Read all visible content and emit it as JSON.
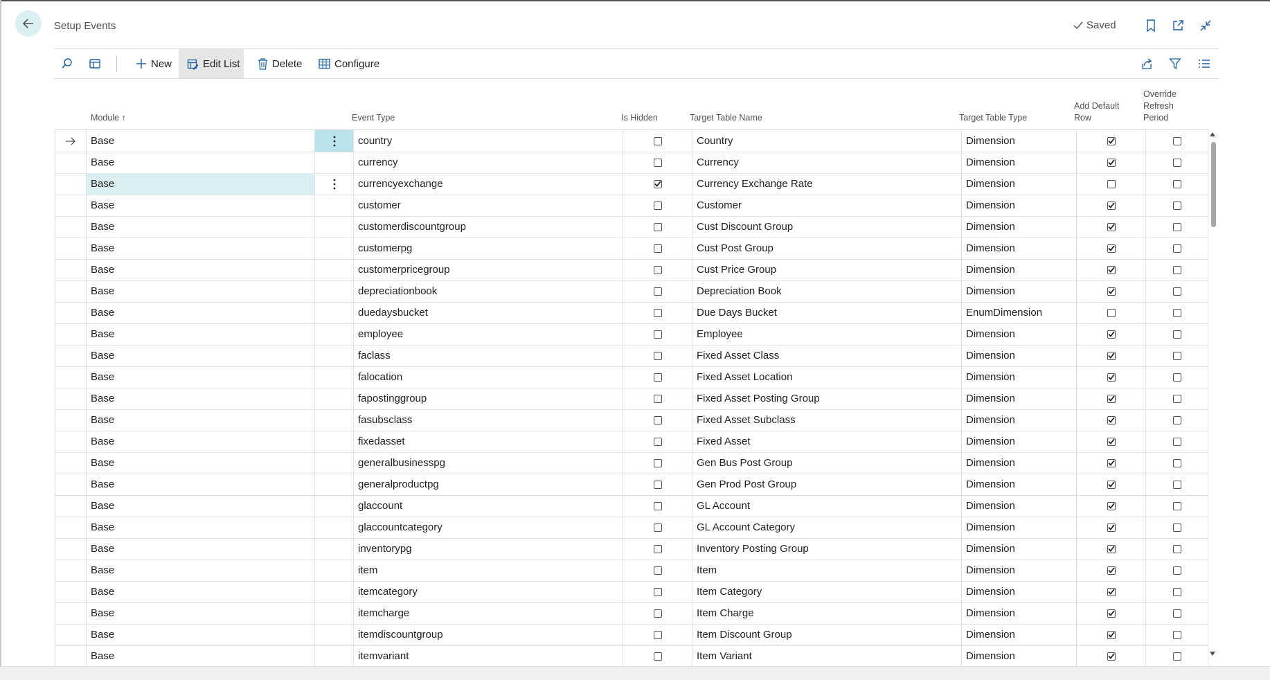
{
  "header": {
    "title": "Setup Events",
    "saved_label": "Saved"
  },
  "actions": {
    "new": "New",
    "edit_list": "Edit List",
    "delete": "Delete",
    "configure": "Configure"
  },
  "columns": {
    "module": "Module",
    "event_type": "Event Type",
    "is_hidden": "Is Hidden",
    "target_table_name": "Target Table Name",
    "target_table_type": "Target Table Type",
    "add_default_row": [
      "Add Default",
      "Row"
    ],
    "override_refresh_period": [
      "Override",
      "Refresh",
      "Period"
    ]
  },
  "rows": [
    {
      "module": "Base",
      "event_type": "country",
      "is_hidden": false,
      "target_table_name": "Country",
      "target_table_type": "Dimension",
      "add_default_row": true,
      "override_refresh_period": false
    },
    {
      "module": "Base",
      "event_type": "currency",
      "is_hidden": false,
      "target_table_name": "Currency",
      "target_table_type": "Dimension",
      "add_default_row": true,
      "override_refresh_period": false
    },
    {
      "module": "Base",
      "event_type": "currencyexchange",
      "is_hidden": true,
      "target_table_name": "Currency Exchange Rate",
      "target_table_type": "Dimension",
      "add_default_row": false,
      "override_refresh_period": false
    },
    {
      "module": "Base",
      "event_type": "customer",
      "is_hidden": false,
      "target_table_name": "Customer",
      "target_table_type": "Dimension",
      "add_default_row": true,
      "override_refresh_period": false
    },
    {
      "module": "Base",
      "event_type": "customerdiscountgroup",
      "is_hidden": false,
      "target_table_name": "Cust Discount Group",
      "target_table_type": "Dimension",
      "add_default_row": true,
      "override_refresh_period": false
    },
    {
      "module": "Base",
      "event_type": "customerpg",
      "is_hidden": false,
      "target_table_name": "Cust Post Group",
      "target_table_type": "Dimension",
      "add_default_row": true,
      "override_refresh_period": false
    },
    {
      "module": "Base",
      "event_type": "customerpricegroup",
      "is_hidden": false,
      "target_table_name": "Cust Price Group",
      "target_table_type": "Dimension",
      "add_default_row": true,
      "override_refresh_period": false
    },
    {
      "module": "Base",
      "event_type": "depreciationbook",
      "is_hidden": false,
      "target_table_name": "Depreciation Book",
      "target_table_type": "Dimension",
      "add_default_row": true,
      "override_refresh_period": false
    },
    {
      "module": "Base",
      "event_type": "duedaysbucket",
      "is_hidden": false,
      "target_table_name": "Due Days Bucket",
      "target_table_type": "EnumDimension",
      "add_default_row": false,
      "override_refresh_period": false
    },
    {
      "module": "Base",
      "event_type": "employee",
      "is_hidden": false,
      "target_table_name": "Employee",
      "target_table_type": "Dimension",
      "add_default_row": true,
      "override_refresh_period": false
    },
    {
      "module": "Base",
      "event_type": "faclass",
      "is_hidden": false,
      "target_table_name": "Fixed Asset Class",
      "target_table_type": "Dimension",
      "add_default_row": true,
      "override_refresh_period": false
    },
    {
      "module": "Base",
      "event_type": "falocation",
      "is_hidden": false,
      "target_table_name": "Fixed Asset Location",
      "target_table_type": "Dimension",
      "add_default_row": true,
      "override_refresh_period": false
    },
    {
      "module": "Base",
      "event_type": "fapostinggroup",
      "is_hidden": false,
      "target_table_name": "Fixed Asset Posting Group",
      "target_table_type": "Dimension",
      "add_default_row": true,
      "override_refresh_period": false
    },
    {
      "module": "Base",
      "event_type": "fasubsclass",
      "is_hidden": false,
      "target_table_name": "Fixed Asset Subclass",
      "target_table_type": "Dimension",
      "add_default_row": true,
      "override_refresh_period": false
    },
    {
      "module": "Base",
      "event_type": "fixedasset",
      "is_hidden": false,
      "target_table_name": "Fixed Asset",
      "target_table_type": "Dimension",
      "add_default_row": true,
      "override_refresh_period": false
    },
    {
      "module": "Base",
      "event_type": "generalbusinesspg",
      "is_hidden": false,
      "target_table_name": "Gen Bus Post Group",
      "target_table_type": "Dimension",
      "add_default_row": true,
      "override_refresh_period": false
    },
    {
      "module": "Base",
      "event_type": "generalproductpg",
      "is_hidden": false,
      "target_table_name": "Gen Prod Post Group",
      "target_table_type": "Dimension",
      "add_default_row": true,
      "override_refresh_period": false
    },
    {
      "module": "Base",
      "event_type": "glaccount",
      "is_hidden": false,
      "target_table_name": "GL Account",
      "target_table_type": "Dimension",
      "add_default_row": true,
      "override_refresh_period": false
    },
    {
      "module": "Base",
      "event_type": "glaccountcategory",
      "is_hidden": false,
      "target_table_name": "GL Account Category",
      "target_table_type": "Dimension",
      "add_default_row": true,
      "override_refresh_period": false
    },
    {
      "module": "Base",
      "event_type": "inventorypg",
      "is_hidden": false,
      "target_table_name": "Inventory Posting Group",
      "target_table_type": "Dimension",
      "add_default_row": true,
      "override_refresh_period": false
    },
    {
      "module": "Base",
      "event_type": "item",
      "is_hidden": false,
      "target_table_name": "Item",
      "target_table_type": "Dimension",
      "add_default_row": true,
      "override_refresh_period": false
    },
    {
      "module": "Base",
      "event_type": "itemcategory",
      "is_hidden": false,
      "target_table_name": "Item Category",
      "target_table_type": "Dimension",
      "add_default_row": true,
      "override_refresh_period": false
    },
    {
      "module": "Base",
      "event_type": "itemcharge",
      "is_hidden": false,
      "target_table_name": "Item Charge",
      "target_table_type": "Dimension",
      "add_default_row": true,
      "override_refresh_period": false
    },
    {
      "module": "Base",
      "event_type": "itemdiscountgroup",
      "is_hidden": false,
      "target_table_name": "Item Discount Group",
      "target_table_type": "Dimension",
      "add_default_row": true,
      "override_refresh_period": false
    },
    {
      "module": "Base",
      "event_type": "itemvariant",
      "is_hidden": false,
      "target_table_name": "Item Variant",
      "target_table_type": "Dimension",
      "add_default_row": true,
      "override_refresh_period": false
    }
  ],
  "selection": {
    "current_row": 0,
    "highlighted_row": 2
  },
  "colors": {
    "accent": "#00788a",
    "selection": "#dbeef2",
    "menu_cell": "#b9e3ea"
  }
}
